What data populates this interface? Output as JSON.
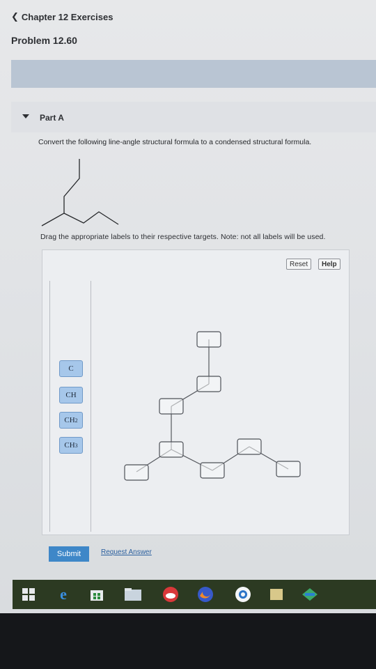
{
  "header": {
    "back_label": "Chapter 12 Exercises",
    "problem_title": "Problem 12.60"
  },
  "part_a": {
    "label": "Part A",
    "instruction": "Convert the following line-angle structural formula to a condensed structural formula.",
    "drag_instruction": "Drag the appropriate labels to their respective targets. Note: not all labels will be used."
  },
  "toolbar": {
    "reset_label": "Reset",
    "help_label": "Help"
  },
  "labels": [
    {
      "base": "C",
      "sub": ""
    },
    {
      "base": "CH",
      "sub": ""
    },
    {
      "base": "CH",
      "sub": "2"
    },
    {
      "base": "CH",
      "sub": "3"
    }
  ],
  "actions": {
    "submit_label": "Submit",
    "request_label": "Request Answer"
  },
  "taskbar": {
    "icons": [
      "windows-start-icon",
      "edge-icon",
      "store-icon",
      "file-explorer-icon",
      "cloud-app-icon",
      "firefox-icon",
      "chrome-icon",
      "sticky-app-icon",
      "network-app-icon"
    ]
  }
}
